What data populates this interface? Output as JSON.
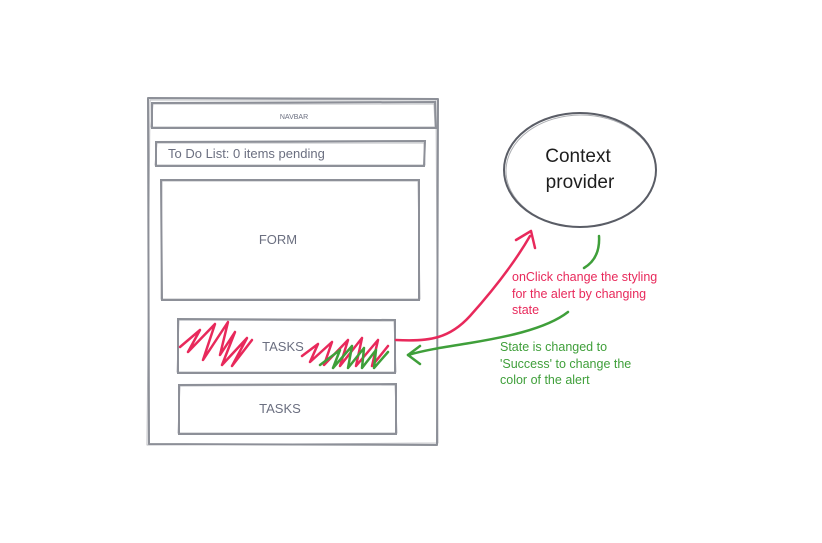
{
  "wireframe": {
    "navbar_label": "NAVBAR",
    "header_text": "To Do List: 0 items pending",
    "form_label": "FORM",
    "tasks_top_label": "TASKS",
    "tasks_bottom_label": "TASKS"
  },
  "context_bubble": {
    "line1": "Context",
    "line2": "provider"
  },
  "annotations": {
    "pink": [
      "onClick change the styling",
      "for the alert by changing",
      "state"
    ],
    "green": [
      "State is changed to",
      "'Success' to change the",
      "color of the alert"
    ]
  },
  "colors": {
    "wireframe_stroke": "#8d9098",
    "pink": "#e8295b",
    "green": "#3f9f3a",
    "bubble_stroke": "#5a5d66"
  }
}
